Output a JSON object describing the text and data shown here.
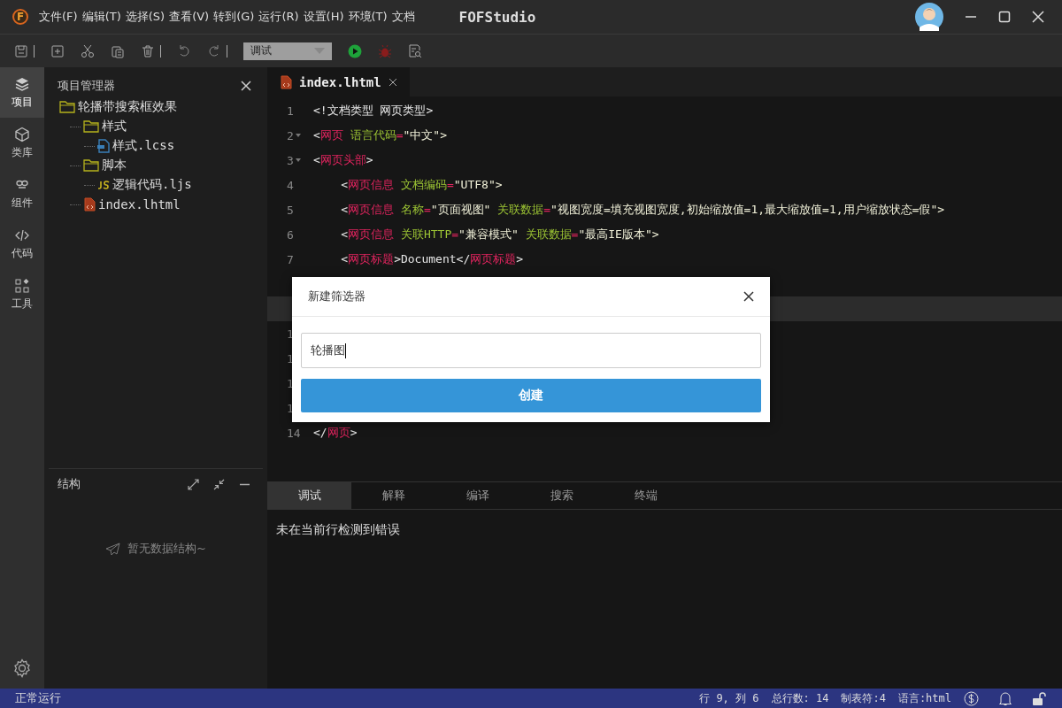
{
  "titlebar": {
    "logo_letter": "F",
    "menu": [
      "文件(F)",
      "编辑(T)",
      "选择(S)",
      "查看(V)",
      "转到(G)",
      "运行(R)",
      "设置(H)",
      "环境(T)",
      "文档"
    ],
    "title": "FOFStudio"
  },
  "toolbar": {
    "mode_select": {
      "value": "调试"
    }
  },
  "activity_bar": [
    {
      "label": "项目",
      "selected": true
    },
    {
      "label": "类库",
      "selected": false
    },
    {
      "label": "组件",
      "selected": false
    },
    {
      "label": "代码",
      "selected": false
    },
    {
      "label": "工具",
      "selected": false
    }
  ],
  "explorer": {
    "title": "项目管理器",
    "tree": [
      {
        "label": "轮播带搜索框效果",
        "kind": "folder",
        "children": [
          {
            "label": "样式",
            "kind": "folder",
            "children": [
              {
                "label": "样式.lcss",
                "kind": "css"
              }
            ]
          },
          {
            "label": "脚本",
            "kind": "folder",
            "children": [
              {
                "label": "逻辑代码.ljs",
                "kind": "js"
              }
            ]
          },
          {
            "label": "index.lhtml",
            "kind": "html"
          }
        ]
      }
    ]
  },
  "structure": {
    "title": "结构",
    "empty_text": "暂无数据结构~"
  },
  "editor": {
    "tabs": [
      {
        "label": "index.lhtml",
        "selected": true
      }
    ],
    "lines": [
      {
        "number": "1",
        "foldable": false,
        "current": false,
        "tokens": [
          {
            "kind": "plain",
            "s": "<!文档类型 网页类型>"
          }
        ]
      },
      {
        "number": "2",
        "foldable": true,
        "current": false,
        "tokens": [
          {
            "kind": "plain",
            "s": "<"
          },
          {
            "kind": "tag",
            "s": "网页"
          },
          {
            "kind": "attr",
            "s": " 语言代码"
          },
          {
            "kind": "eq",
            "s": "="
          },
          {
            "kind": "str",
            "s": "\"中文\">"
          }
        ]
      },
      {
        "number": "3",
        "foldable": true,
        "current": false,
        "tokens": [
          {
            "kind": "plain",
            "s": "<"
          },
          {
            "kind": "tag",
            "s": "网页头部"
          },
          {
            "kind": "plain",
            "s": ">"
          }
        ]
      },
      {
        "number": "4",
        "foldable": false,
        "current": false,
        "tokens": [
          {
            "kind": "plain",
            "s": "    <"
          },
          {
            "kind": "tag",
            "s": "网页信息"
          },
          {
            "kind": "attr",
            "s": " 文档编码"
          },
          {
            "kind": "eq",
            "s": "="
          },
          {
            "kind": "str",
            "s": "\"UTF8\">"
          }
        ]
      },
      {
        "number": "5",
        "foldable": false,
        "current": false,
        "tokens": [
          {
            "kind": "plain",
            "s": "    <"
          },
          {
            "kind": "tag",
            "s": "网页信息"
          },
          {
            "kind": "attr",
            "s": " 名称"
          },
          {
            "kind": "eq",
            "s": "="
          },
          {
            "kind": "str",
            "s": "\"页面视图\""
          },
          {
            "kind": "attr",
            "s": " 关联数据"
          },
          {
            "kind": "eq",
            "s": "="
          },
          {
            "kind": "str",
            "s": "\"视图宽度=填充视图宽度,初始缩放值=1,最大缩放值=1,用户缩放状态=假\">"
          }
        ]
      },
      {
        "number": "6",
        "foldable": false,
        "current": false,
        "tokens": [
          {
            "kind": "plain",
            "s": "    <"
          },
          {
            "kind": "tag",
            "s": "网页信息"
          },
          {
            "kind": "attr",
            "s": " 关联HTTP"
          },
          {
            "kind": "eq",
            "s": "="
          },
          {
            "kind": "str",
            "s": "\"兼容模式\""
          },
          {
            "kind": "attr",
            "s": " 关联数据"
          },
          {
            "kind": "eq",
            "s": "="
          },
          {
            "kind": "str",
            "s": "\"最高IE版本\">"
          }
        ]
      },
      {
        "number": "7",
        "foldable": false,
        "current": false,
        "tokens": [
          {
            "kind": "plain",
            "s": "    <"
          },
          {
            "kind": "tag",
            "s": "网页标题"
          },
          {
            "kind": "plain",
            "s": ">Document</"
          },
          {
            "kind": "tag",
            "s": "网页标题"
          },
          {
            "kind": "plain",
            "s": ">"
          }
        ]
      },
      {
        "current": false
      },
      {
        "current": true
      },
      {
        "number": "1",
        "current": false
      },
      {
        "number": "1",
        "current": false
      },
      {
        "number": "1",
        "current": false
      },
      {
        "number": "1",
        "current": false
      },
      {
        "number": "14",
        "foldable": false,
        "current": false,
        "tokens": [
          {
            "kind": "plain",
            "s": "</"
          },
          {
            "kind": "tag",
            "s": "网页"
          },
          {
            "kind": "plain",
            "s": ">"
          }
        ]
      }
    ]
  },
  "dialog": {
    "title": "新建筛选器",
    "input_value": "轮播图",
    "button": "创建"
  },
  "output_panel": {
    "tabs": [
      {
        "label": "调试",
        "selected": true
      },
      {
        "label": "解释",
        "selected": false
      },
      {
        "label": "编译",
        "selected": false
      },
      {
        "label": "搜索",
        "selected": false
      },
      {
        "label": "终端",
        "selected": false
      }
    ],
    "message": "未在当前行检测到错误"
  },
  "status_bar": {
    "left": "正常运行",
    "items": [
      "行 9, 列 6",
      "总行数: 14",
      "制表符:4",
      "语言:html"
    ]
  }
}
